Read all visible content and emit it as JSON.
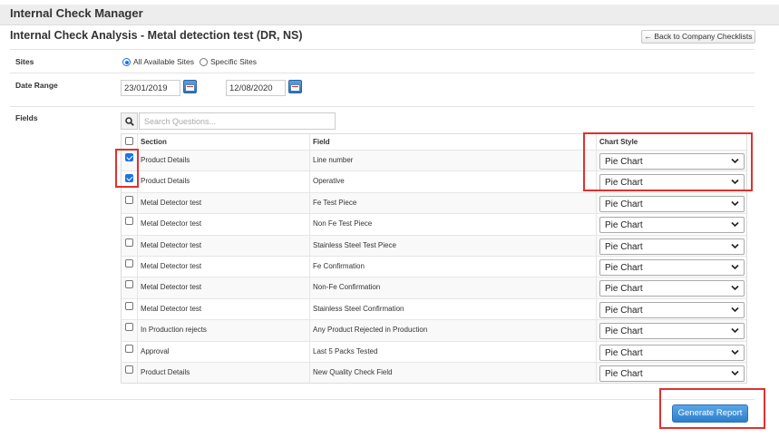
{
  "app": {
    "title": "Internal Check Manager"
  },
  "page": {
    "title": "Internal Check Analysis - Metal detection test (DR, NS)",
    "back_label": "← Back to Company Checklists"
  },
  "sites": {
    "label": "Sites",
    "options": [
      {
        "label": "All Available Sites",
        "selected": true
      },
      {
        "label": "Specific Sites",
        "selected": false
      }
    ]
  },
  "date_range": {
    "label": "Date Range",
    "from": "23/01/2019",
    "to": "12/08/2020"
  },
  "fields": {
    "label": "Fields",
    "search_placeholder": "Search Questions...",
    "columns": {
      "section": "Section",
      "field": "Field",
      "chart_style": "Chart Style"
    },
    "rows": [
      {
        "checked": true,
        "section": "Product Details",
        "field": "Line number",
        "chart_style": "Pie Chart"
      },
      {
        "checked": true,
        "section": "Product Details",
        "field": "Operative",
        "chart_style": "Pie Chart"
      },
      {
        "checked": false,
        "section": "Metal Detector test",
        "field": "Fe Test Piece",
        "chart_style": "Pie Chart"
      },
      {
        "checked": false,
        "section": "Metal Detector test",
        "field": "Non Fe Test Piece",
        "chart_style": "Pie Chart"
      },
      {
        "checked": false,
        "section": "Metal Detector test",
        "field": "Stainless Steel Test Piece",
        "chart_style": "Pie Chart"
      },
      {
        "checked": false,
        "section": "Metal Detector test",
        "field": "Fe Confirmation",
        "chart_style": "Pie Chart"
      },
      {
        "checked": false,
        "section": "Metal Detector test",
        "field": "Non-Fe Confirmation",
        "chart_style": "Pie Chart"
      },
      {
        "checked": false,
        "section": "Metal Detector test",
        "field": "Stainless Steel Confirmation",
        "chart_style": "Pie Chart"
      },
      {
        "checked": false,
        "section": "In Production rejects",
        "field": "Any Product Rejected in Production",
        "chart_style": "Pie Chart"
      },
      {
        "checked": false,
        "section": "Approval",
        "field": "Last 5 Packs Tested",
        "chart_style": "Pie Chart"
      },
      {
        "checked": false,
        "section": "Product Details",
        "field": "New Quality Check Field",
        "chart_style": "Pie Chart"
      }
    ]
  },
  "actions": {
    "generate_label": "Generate Report"
  },
  "colors": {
    "accent": "#2c7fcb",
    "highlight": "#e0312e",
    "header_bg": "#ededed"
  }
}
